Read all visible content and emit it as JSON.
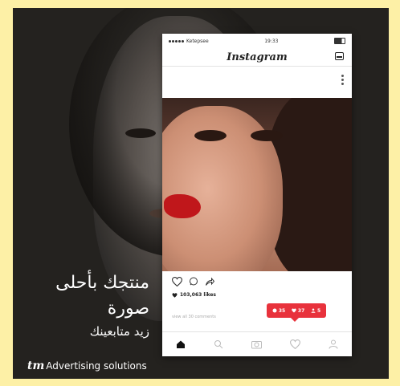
{
  "ad": {
    "headline_line1": "منتجك بأحلى",
    "headline_line2": "صورة",
    "subline": "زيد متابعينك",
    "brand_logo": "tm",
    "brand_tagline": "Advertising solutions"
  },
  "phone": {
    "status": {
      "carrier": "Ketepsee",
      "time": "19:33"
    },
    "app_title": "Instagram",
    "likes": "103,063 likes",
    "comments": "view all 30 comments",
    "notification": {
      "comments": "35",
      "likes": "37",
      "followers": "5"
    }
  },
  "colors": {
    "background": "#fdf0a6",
    "photo_frame": "#24221f",
    "notification": "#e8323c"
  },
  "icons": [
    "heart-icon",
    "comment-icon",
    "share-icon",
    "home-icon",
    "search-icon",
    "camera-icon",
    "activity-icon",
    "profile-icon",
    "inbox-icon",
    "more-icon"
  ]
}
